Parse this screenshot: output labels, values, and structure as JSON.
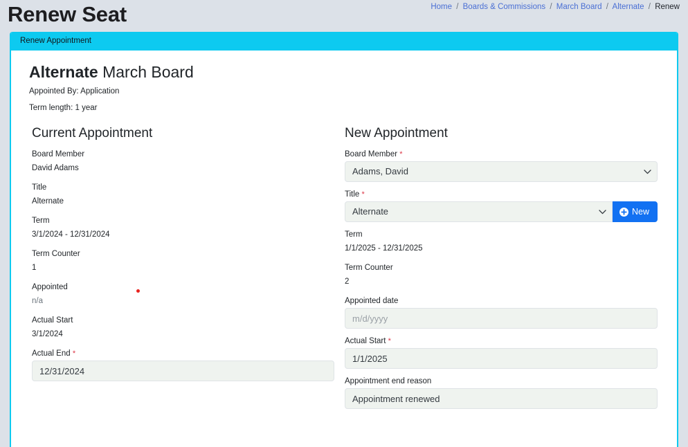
{
  "header": {
    "title": "Renew Seat",
    "breadcrumb": [
      {
        "label": "Home",
        "current": false
      },
      {
        "label": "Boards & Commissions",
        "current": false
      },
      {
        "label": "March Board",
        "current": false
      },
      {
        "label": "Alternate",
        "current": false
      },
      {
        "label": "Renew",
        "current": true
      }
    ],
    "separator": "/"
  },
  "card": {
    "tab_label": "Renew Appointment",
    "accent_color": "#0dcaf0"
  },
  "seat": {
    "title_bold": "Alternate",
    "title_light": "March Board",
    "appointed_by": "Appointed By: Application",
    "term_length": "Term length: 1 year"
  },
  "current_appointment": {
    "section_title": "Current Appointment",
    "fields": [
      {
        "label": "Board Member",
        "value": "David Adams"
      },
      {
        "label": "Title",
        "value": "Alternate"
      },
      {
        "label": "Term",
        "value": "3/1/2024 - 12/31/2024"
      },
      {
        "label": "Term Counter",
        "value": "1"
      },
      {
        "label": "Appointed",
        "value": "n/a"
      },
      {
        "label": "Actual Start",
        "value": "3/1/2024"
      }
    ],
    "actual_end": {
      "label": "Actual End",
      "required_marker": "*",
      "value": "12/31/2024",
      "placeholder": "m/d/yyyy"
    }
  },
  "new_appointment": {
    "section_title": "New Appointment",
    "board_member": {
      "label": "Board Member",
      "required_marker": "*",
      "value": "Adams, David",
      "icon": "chevron-down-icon"
    },
    "title": {
      "label": "Title",
      "required_marker": "*",
      "value": "Alternate",
      "icon": "chevron-down-icon",
      "new_button": {
        "label": "New",
        "icon": "plus-circle-icon",
        "color": "#1271f2"
      }
    },
    "term": {
      "label": "Term",
      "value": "1/1/2025 - 12/31/2025"
    },
    "term_counter": {
      "label": "Term Counter",
      "value": "2"
    },
    "appointed_date": {
      "label": "Appointed date",
      "value": "",
      "placeholder": "m/d/yyyy"
    },
    "actual_start": {
      "label": "Actual Start",
      "required_marker": "*",
      "value": "1/1/2025",
      "placeholder": "m/d/yyyy"
    },
    "end_reason": {
      "label": "Appointment end reason",
      "value": "Appointment renewed",
      "placeholder": ""
    }
  },
  "cursor": {
    "name": "click-marker",
    "color": "#e8231f"
  }
}
